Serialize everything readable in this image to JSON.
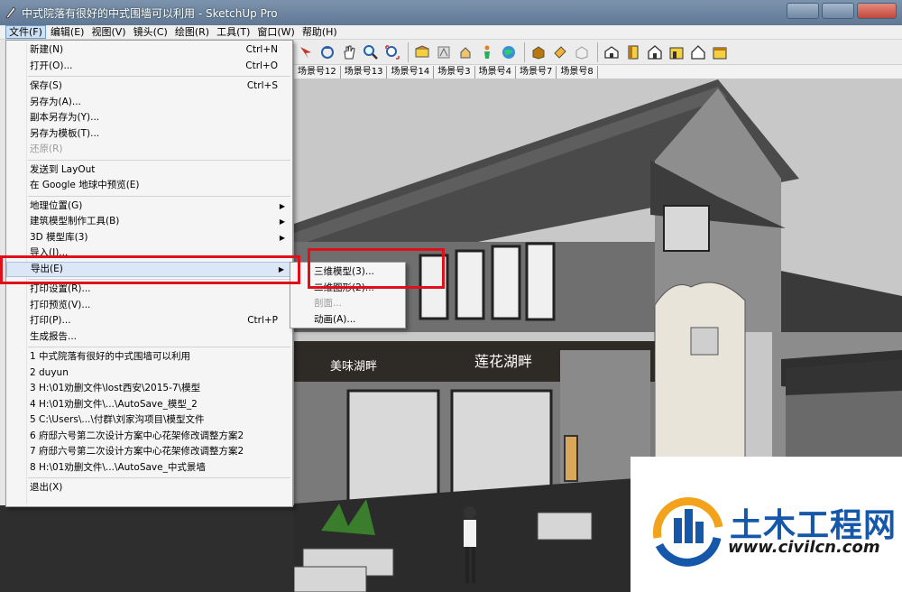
{
  "window": {
    "title": "中式院落有很好的中式围墙可以利用 - SketchUp Pro"
  },
  "menubar": [
    "文件(F)",
    "编辑(E)",
    "视图(V)",
    "镜头(C)",
    "绘图(R)",
    "工具(T)",
    "窗口(W)",
    "帮助(H)"
  ],
  "scene_tabs": [
    "场景号12",
    "场景号13",
    "场景号14",
    "场景号3",
    "场景号4",
    "场景号7",
    "场景号8"
  ],
  "file_menu": {
    "new": {
      "label": "新建(N)",
      "shortcut": "Ctrl+N"
    },
    "open": {
      "label": "打开(O)...",
      "shortcut": "Ctrl+O"
    },
    "save": {
      "label": "保存(S)",
      "shortcut": "Ctrl+S"
    },
    "save_as": {
      "label": "另存为(A)..."
    },
    "save_copy_as": {
      "label": "副本另存为(Y)..."
    },
    "save_as_template": {
      "label": "另存为模板(T)..."
    },
    "revert": {
      "label": "还原(R)"
    },
    "send_to_layout": {
      "label": "发送到 LayOut"
    },
    "preview_google_earth": {
      "label": "在 Google 地球中预览(E)"
    },
    "geo_location": {
      "label": "地理位置(G)"
    },
    "building_maker": {
      "label": "建筑模型制作工具(B)"
    },
    "warehouse_3d": {
      "label": "3D 模型库(3)"
    },
    "import": {
      "label": "导入(I)..."
    },
    "export": {
      "label": "导出(E)"
    },
    "print_setup": {
      "label": "打印设置(R)..."
    },
    "print_preview": {
      "label": "打印预览(V)..."
    },
    "print": {
      "label": "打印(P)...",
      "shortcut": "Ctrl+P"
    },
    "generate_report": {
      "label": "生成报告..."
    },
    "recent": [
      "1 中式院落有很好的中式围墙可以利用",
      "2 duyun",
      "3 H:\\01劝删文件\\lost西安\\2015-7\\模型",
      "4 H:\\01劝删文件\\...\\AutoSave_模型_2",
      "5 C:\\Users\\...\\付群\\刘家沟项目\\模型文件",
      "6 府邸六号第二次设计方案中心花架修改调整方案2",
      "7 府邸六号第二次设计方案中心花架修改调整方案2",
      "8 H:\\01劝删文件\\...\\AutoSave_中式景墙"
    ],
    "exit": {
      "label": "退出(X)"
    }
  },
  "export_submenu": {
    "model_3d": "三维模型(3)...",
    "graphic_2d": "二维图形(2)...",
    "section": "剖面...",
    "animation": "动画(A)..."
  },
  "scene": {
    "sign_left": "美味湖畔",
    "sign_right": "莲花湖畔"
  },
  "watermark": {
    "brand": "土木工程网",
    "url": "www.civilcn.com"
  },
  "colors": {
    "highlight_box": "#e0101b",
    "menu_highlight": "#dbe7f6",
    "watermark_blue": "#1557a8"
  }
}
